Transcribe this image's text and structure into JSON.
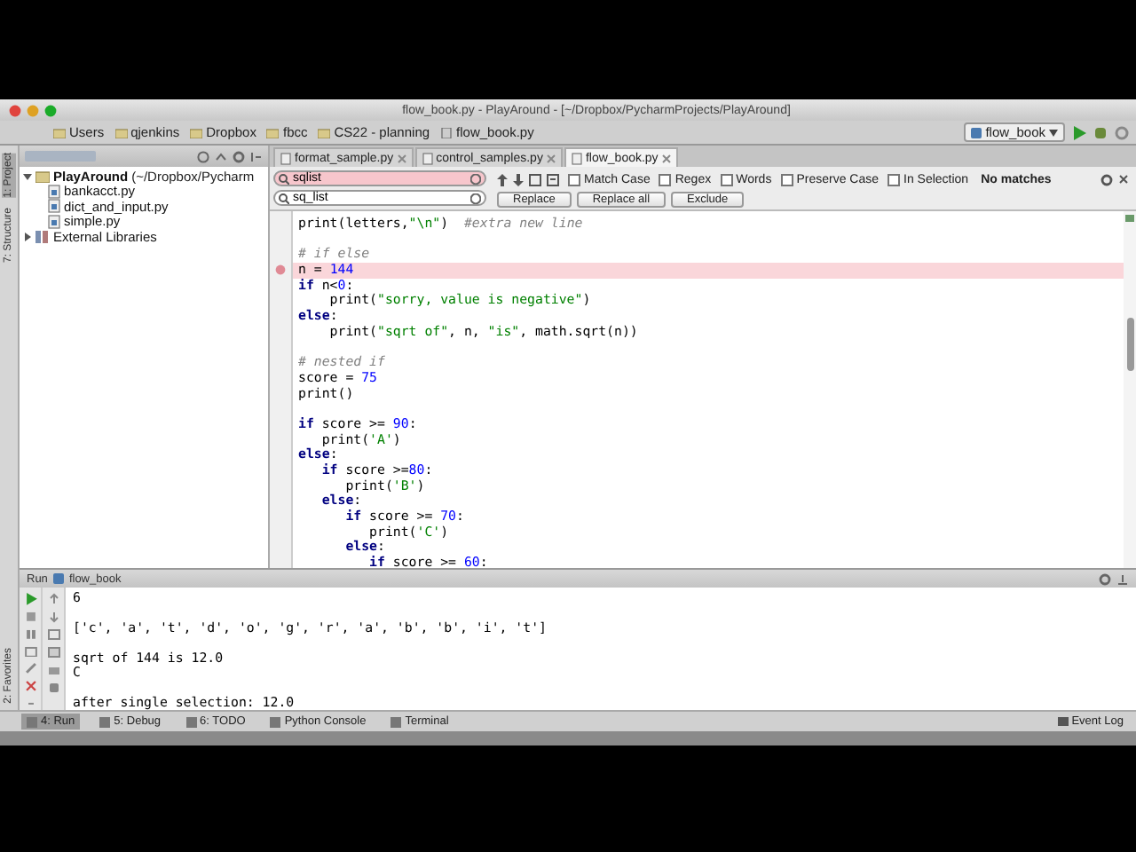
{
  "window": {
    "title": "flow_book.py - PlayAround - [~/Dropbox/PycharmProjects/PlayAround]"
  },
  "breadcrumbs": [
    "Users",
    "qjenkins",
    "Dropbox",
    "fbcc",
    "CS22 - planning",
    "flow_book.py"
  ],
  "run_config": {
    "label": "flow_book"
  },
  "left_stripe": [
    {
      "label": "1: Project",
      "selected": true
    },
    {
      "label": "7: Structure",
      "selected": false
    }
  ],
  "left_stripe_bottom": [
    {
      "label": "2: Favorites",
      "selected": false
    }
  ],
  "project_tree": [
    {
      "label": "PlayAround",
      "path": "(~/Dropbox/Pycharm",
      "kind": "folder",
      "expanded": true,
      "children": [
        {
          "label": "bankacct.py",
          "kind": "file"
        },
        {
          "label": "dict_and_input.py",
          "kind": "file"
        },
        {
          "label": "simple.py",
          "kind": "file"
        }
      ]
    },
    {
      "label": "External Libraries",
      "kind": "library",
      "expanded": false
    }
  ],
  "tabs": [
    {
      "label": "format_sample.py",
      "selected": false
    },
    {
      "label": "control_samples.py",
      "selected": false
    },
    {
      "label": "flow_book.py",
      "selected": true
    }
  ],
  "find": {
    "search": "sqlist",
    "replace": "sq_list",
    "no_match": true,
    "options": [
      {
        "label": "Match Case",
        "checked": false
      },
      {
        "label": "Regex",
        "checked": false
      },
      {
        "label": "Words",
        "checked": false
      },
      {
        "label": "Preserve Case",
        "checked": false
      },
      {
        "label": "In Selection",
        "checked": false
      }
    ],
    "status": "No matches",
    "buttons": [
      "Replace",
      "Replace all",
      "Exclude"
    ]
  },
  "code_blocks": [
    [
      {
        "segments": [
          {
            "text": "print(letters,",
            "kind": "plain"
          },
          {
            "text": "\"\\n\"",
            "kind": "string"
          },
          {
            "text": ")  ",
            "kind": "plain"
          },
          {
            "text": "#extra new line",
            "kind": "comment"
          }
        ]
      }
    ],
    [
      {
        "segments": [
          {
            "text": "# if else",
            "kind": "comment"
          }
        ]
      },
      {
        "breakpoint": true,
        "segments": [
          {
            "text": "n = ",
            "kind": "plain"
          },
          {
            "text": "144",
            "kind": "number"
          }
        ]
      },
      {
        "segments": [
          {
            "text": "if",
            "kind": "keyword"
          },
          {
            "text": " n<",
            "kind": "plain"
          },
          {
            "text": "0",
            "kind": "number"
          },
          {
            "text": ":",
            "kind": "plain"
          }
        ]
      },
      {
        "segments": [
          {
            "text": "    print(",
            "kind": "plain"
          },
          {
            "text": "\"sorry, value is negative\"",
            "kind": "string"
          },
          {
            "text": ")",
            "kind": "plain"
          }
        ]
      },
      {
        "segments": [
          {
            "text": "else",
            "kind": "keyword"
          },
          {
            "text": ":",
            "kind": "plain"
          }
        ]
      },
      {
        "segments": [
          {
            "text": "    print(",
            "kind": "plain"
          },
          {
            "text": "\"sqrt of\"",
            "kind": "string"
          },
          {
            "text": ", n, ",
            "kind": "plain"
          },
          {
            "text": "\"is\"",
            "kind": "string"
          },
          {
            "text": ", math.sqrt(n))",
            "kind": "plain"
          }
        ]
      }
    ],
    [
      {
        "segments": [
          {
            "text": "# nested if",
            "kind": "comment"
          }
        ]
      },
      {
        "segments": [
          {
            "text": "score = ",
            "kind": "plain"
          },
          {
            "text": "75",
            "kind": "number"
          }
        ]
      },
      {
        "segments": [
          {
            "text": "print()",
            "kind": "plain"
          }
        ]
      }
    ],
    [
      {
        "segments": [
          {
            "text": "if",
            "kind": "keyword"
          },
          {
            "text": " score >= ",
            "kind": "plain"
          },
          {
            "text": "90",
            "kind": "number"
          },
          {
            "text": ":",
            "kind": "plain"
          }
        ]
      },
      {
        "segments": [
          {
            "text": "   print(",
            "kind": "plain"
          },
          {
            "text": "'A'",
            "kind": "string"
          },
          {
            "text": ")",
            "kind": "plain"
          }
        ]
      },
      {
        "segments": [
          {
            "text": "else",
            "kind": "keyword"
          },
          {
            "text": ":",
            "kind": "plain"
          }
        ]
      },
      {
        "segments": [
          {
            "text": "   if",
            "kind": "keyword"
          },
          {
            "text": " score >=",
            "kind": "plain"
          },
          {
            "text": "80",
            "kind": "number"
          },
          {
            "text": ":",
            "kind": "plain"
          }
        ]
      },
      {
        "segments": [
          {
            "text": "      print(",
            "kind": "plain"
          },
          {
            "text": "'B'",
            "kind": "string"
          },
          {
            "text": ")",
            "kind": "plain"
          }
        ]
      },
      {
        "segments": [
          {
            "text": "   else",
            "kind": "keyword"
          },
          {
            "text": ":",
            "kind": "plain"
          }
        ]
      },
      {
        "segments": [
          {
            "text": "      if",
            "kind": "keyword"
          },
          {
            "text": " score >= ",
            "kind": "plain"
          },
          {
            "text": "70",
            "kind": "number"
          },
          {
            "text": ":",
            "kind": "plain"
          }
        ]
      },
      {
        "segments": [
          {
            "text": "         print(",
            "kind": "plain"
          },
          {
            "text": "'C'",
            "kind": "string"
          },
          {
            "text": ")",
            "kind": "plain"
          }
        ]
      },
      {
        "segments": [
          {
            "text": "      else",
            "kind": "keyword"
          },
          {
            "text": ":",
            "kind": "plain"
          }
        ]
      },
      {
        "segments": [
          {
            "text": "         if",
            "kind": "keyword"
          },
          {
            "text": " score >= ",
            "kind": "plain"
          },
          {
            "text": "60",
            "kind": "number"
          },
          {
            "text": ":",
            "kind": "plain"
          }
        ]
      }
    ]
  ],
  "run_panel": {
    "title": "Run",
    "config": "flow_book",
    "output_blocks": [
      [
        "6"
      ],
      [
        "['c', 'a', 't', 'd', 'o', 'g', 'r', 'a', 'b', 'b', 'i', 't']"
      ],
      [
        "sqrt of 144 is 12.0",
        "C"
      ],
      [
        "after single selection: 12.0"
      ]
    ]
  },
  "tool_windows": [
    {
      "label": "4: Run",
      "selected": true
    },
    {
      "label": "5: Debug",
      "selected": false
    },
    {
      "label": "6: TODO",
      "selected": false
    },
    {
      "label": "Python Console",
      "selected": false
    },
    {
      "label": "Terminal",
      "selected": false
    }
  ],
  "event_log": "Event Log"
}
